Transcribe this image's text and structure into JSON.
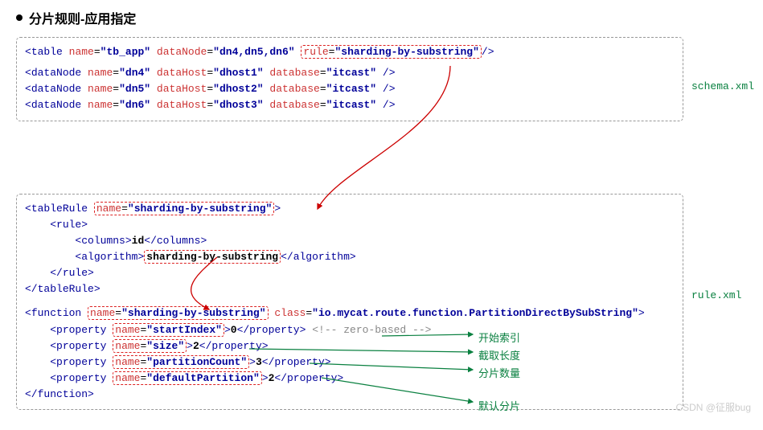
{
  "heading": "分片规则-应用指定",
  "labels": {
    "schema": "schema.xml",
    "rule": "rule.xml"
  },
  "schema": {
    "table": {
      "tag": "table",
      "name_attr": "name",
      "name_val": "tb_app",
      "dn_attr": "dataNode",
      "dn_val": "dn4,dn5,dn6",
      "rule_attr": "rule",
      "rule_val": "sharding-by-substring"
    },
    "nodes": [
      {
        "tag": "dataNode",
        "name": "dn4",
        "host": "dhost1",
        "db": "itcast"
      },
      {
        "tag": "dataNode",
        "name": "dn5",
        "host": "dhost2",
        "db": "itcast"
      },
      {
        "tag": "dataNode",
        "name": "dn6",
        "host": "dhost3",
        "db": "itcast"
      }
    ],
    "attrs": {
      "name": "name",
      "dataHost": "dataHost",
      "database": "database"
    }
  },
  "rule": {
    "tableRule": {
      "tag": "tableRule",
      "name_attr": "name",
      "name_val": "sharding-by-substring",
      "rule_tag": "rule",
      "columns_tag": "columns",
      "columns_val": "id",
      "algo_tag": "algorithm",
      "algo_val": "sharding-by-substring"
    },
    "func": {
      "tag": "function",
      "name_attr": "name",
      "name_val": "sharding-by-substring",
      "class_attr": "class",
      "class_val": "io.mycat.route.function.PartitionDirectBySubString",
      "props": [
        {
          "name": "startIndex",
          "val": "0",
          "comment": "<!-- zero-based -->"
        },
        {
          "name": "size",
          "val": "2",
          "comment": ""
        },
        {
          "name": "partitionCount",
          "val": "3",
          "comment": ""
        },
        {
          "name": "defaultPartition",
          "val": "2",
          "comment": ""
        }
      ],
      "prop_tag": "property"
    }
  },
  "annotations": {
    "a1": "开始索引",
    "a2": "截取长度",
    "a3": "分片数量",
    "a4": "默认分片"
  },
  "watermark": "CSDN @征服bug"
}
